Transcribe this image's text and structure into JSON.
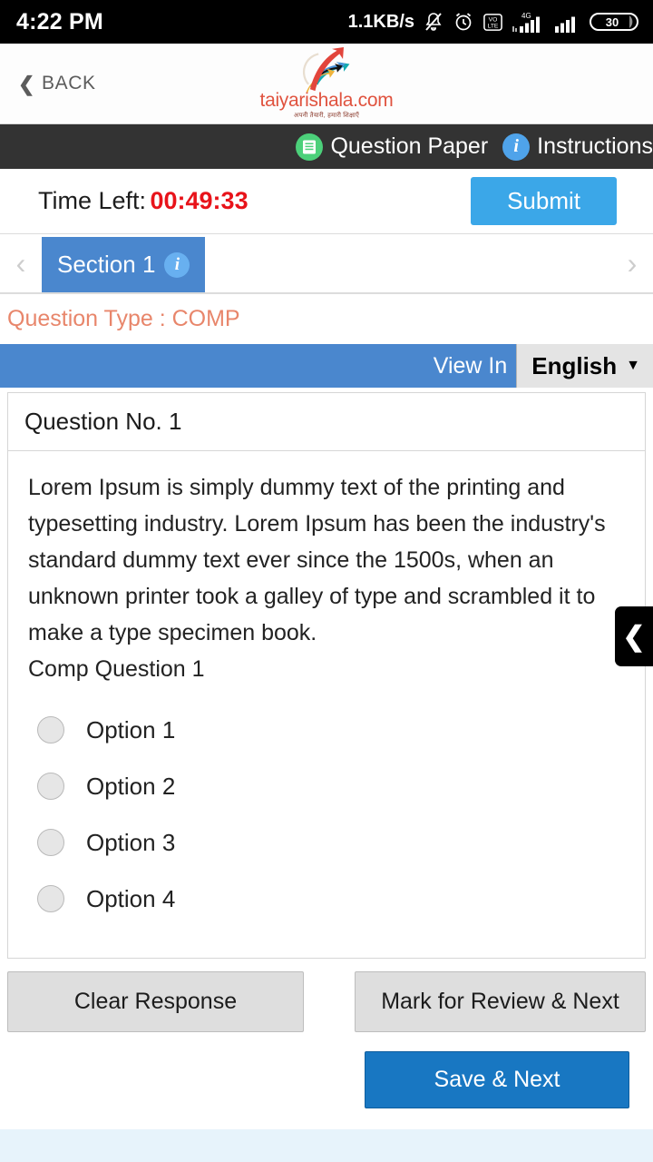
{
  "status_bar": {
    "time": "4:22 PM",
    "network_speed": "1.1KB/s",
    "battery_level": "30",
    "icons": [
      "bell-muted-icon",
      "alarm-clock-icon",
      "volte-icon",
      "signal-4g-icon",
      "signal-icon",
      "battery-icon"
    ]
  },
  "header": {
    "back_label": "BACK",
    "logo_text": "taiyarishala.com",
    "logo_tagline": "अपनी तैयारी, हमारी शिक्षाएँ"
  },
  "nav": {
    "question_paper_label": "Question Paper",
    "instructions_label": "Instructions",
    "question_paper_icon": "document-list-icon",
    "instructions_icon": "info-icon"
  },
  "timer": {
    "label": "Time Left:",
    "value": "00:49:33",
    "submit_label": "Submit"
  },
  "sections": {
    "prev_arrow": "‹",
    "next_arrow": "›",
    "tabs": [
      {
        "label": "Section 1",
        "info_icon": "info-icon",
        "active": true
      }
    ]
  },
  "question_type": {
    "text": "Question Type : COMP"
  },
  "view_in": {
    "label": "View In",
    "selected_language": "English",
    "caret": "▼",
    "options": [
      "English"
    ]
  },
  "question": {
    "number_label": "Question No. 1",
    "passage": "Lorem Ipsum is simply dummy text of the printing and typesetting industry. Lorem Ipsum has been the industry's standard dummy text ever since the 1500s, when an unknown printer took a galley of type and scrambled it to make a type specimen book.",
    "prompt": "Comp Question 1",
    "options": [
      {
        "label": "Option 1",
        "selected": false
      },
      {
        "label": "Option 2",
        "selected": false
      },
      {
        "label": "Option 3",
        "selected": false
      },
      {
        "label": "Option 4",
        "selected": false
      }
    ]
  },
  "side_panel_toggle": {
    "icon": "chevron-left-icon"
  },
  "footer": {
    "clear_label": "Clear Response",
    "mark_label": "Mark for Review & Next",
    "save_label": "Save & Next"
  },
  "colors": {
    "accent_blue": "#4a87ce",
    "submit_blue": "#3BA7E8",
    "save_blue": "#1877c2",
    "timer_red": "#e8131a",
    "question_type_orange": "#e8866b",
    "nav_dark": "#333333",
    "logo_red": "#e0533f"
  }
}
